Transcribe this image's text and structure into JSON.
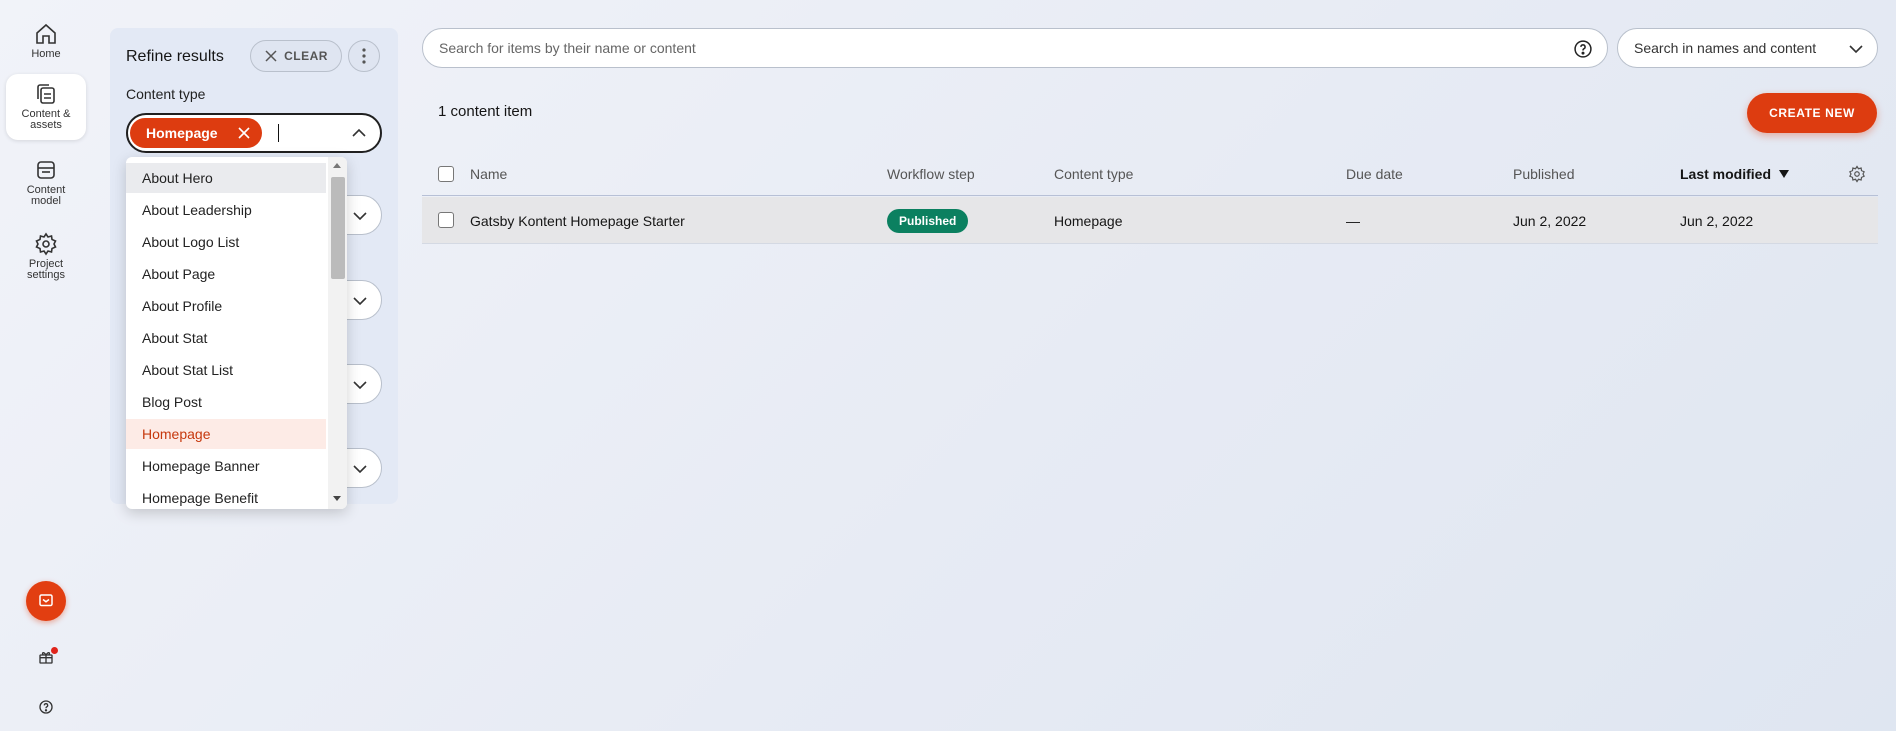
{
  "nav": {
    "items": [
      {
        "label": "Home",
        "icon": "home-icon"
      },
      {
        "label": "Content & assets",
        "icon": "content-assets-icon"
      },
      {
        "label": "Content model",
        "icon": "content-model-icon"
      },
      {
        "label": "Project settings",
        "icon": "gear-icon"
      }
    ],
    "active_index": 1
  },
  "filters": {
    "title": "Refine results",
    "clear_label": "CLEAR",
    "content_type_label": "Content type",
    "selected_tag": "Homepage",
    "dropdown_options": [
      "About Hero",
      "About Leadership",
      "About Logo List",
      "About Page",
      "About Profile",
      "About Stat",
      "About Stat List",
      "Blog Post",
      "Homepage",
      "Homepage Banner",
      "Homepage Benefit"
    ],
    "hovered_option": "About Hero",
    "selected_option": "Homepage"
  },
  "search": {
    "placeholder": "Search for items by their name or content",
    "scope": "Search in names and content"
  },
  "list": {
    "count_label": "1 content item",
    "create_label": "CREATE NEW",
    "columns": {
      "name": "Name",
      "workflow": "Workflow step",
      "content_type": "Content type",
      "due_date": "Due date",
      "published": "Published",
      "last_modified": "Last modified"
    },
    "rows": [
      {
        "name": "Gatsby Kontent Homepage Starter",
        "workflow": "Published",
        "content_type": "Homepage",
        "due_date": "—",
        "published": "Jun 2, 2022",
        "last_modified": "Jun 2, 2022"
      }
    ]
  },
  "colors": {
    "accent": "#dd3c10",
    "published_badge": "#0b8060"
  }
}
